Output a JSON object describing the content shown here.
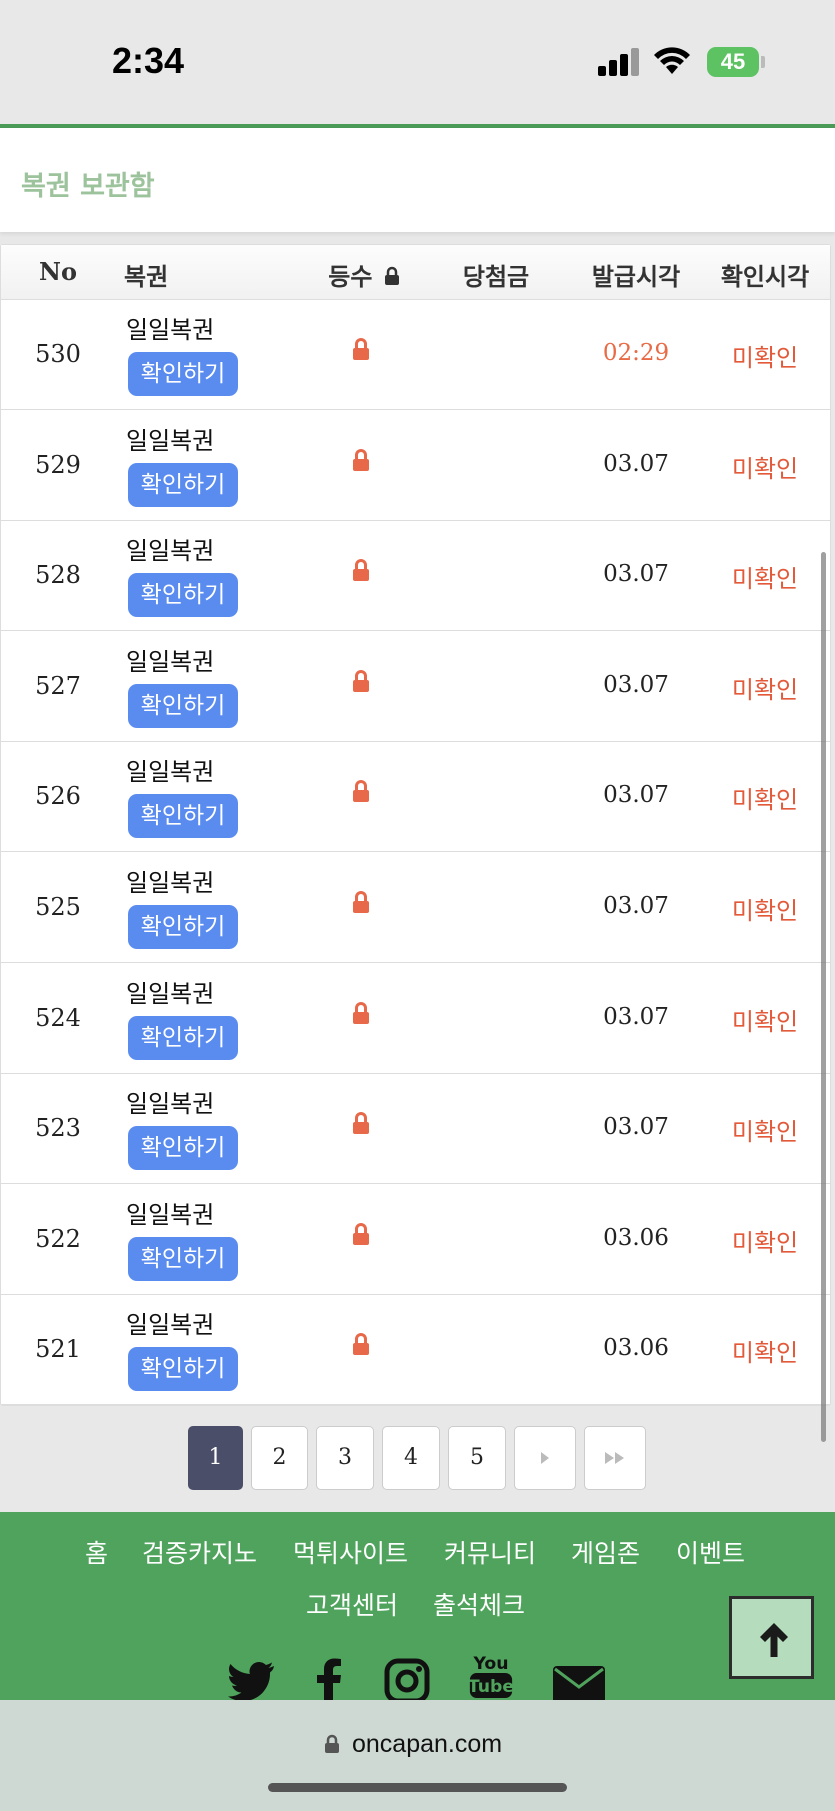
{
  "status_bar": {
    "time": "2:34",
    "battery": "45"
  },
  "header": {
    "title": "복권 보관함"
  },
  "table": {
    "headers": {
      "no": "No",
      "ticket": "복권",
      "rank": "등수",
      "prize": "당첨금",
      "issued": "발급시각",
      "confirmed": "확인시각"
    },
    "rows": [
      {
        "no": "530",
        "name": "일일복권",
        "button": "확인하기",
        "issued": "02:29",
        "status": "미확인"
      },
      {
        "no": "529",
        "name": "일일복권",
        "button": "확인하기",
        "issued": "03.07",
        "status": "미확인"
      },
      {
        "no": "528",
        "name": "일일복권",
        "button": "확인하기",
        "issued": "03.07",
        "status": "미확인"
      },
      {
        "no": "527",
        "name": "일일복권",
        "button": "확인하기",
        "issued": "03.07",
        "status": "미확인"
      },
      {
        "no": "526",
        "name": "일일복권",
        "button": "확인하기",
        "issued": "03.07",
        "status": "미확인"
      },
      {
        "no": "525",
        "name": "일일복권",
        "button": "확인하기",
        "issued": "03.07",
        "status": "미확인"
      },
      {
        "no": "524",
        "name": "일일복권",
        "button": "확인하기",
        "issued": "03.07",
        "status": "미확인"
      },
      {
        "no": "523",
        "name": "일일복권",
        "button": "확인하기",
        "issued": "03.07",
        "status": "미확인"
      },
      {
        "no": "522",
        "name": "일일복권",
        "button": "확인하기",
        "issued": "03.06",
        "status": "미확인"
      },
      {
        "no": "521",
        "name": "일일복권",
        "button": "확인하기",
        "issued": "03.06",
        "status": "미확인"
      }
    ]
  },
  "pagination": {
    "pages": [
      "1",
      "2",
      "3",
      "4",
      "5"
    ],
    "current": "1"
  },
  "footer": {
    "links": [
      "홈",
      "검증카지노",
      "먹튀사이트",
      "커뮤니티",
      "게임존",
      "이벤트",
      "고객센터",
      "출석체크"
    ],
    "social_icons": [
      "twitter-icon",
      "facebook-icon",
      "instagram-icon",
      "youtube-icon",
      "mail-icon"
    ]
  },
  "browser": {
    "url": "oncapan.com"
  },
  "colors": {
    "accent_green": "#4fa35c",
    "button_blue": "#5a8cf0",
    "status_red": "#e25a3a",
    "active_page": "#4a4e68"
  }
}
